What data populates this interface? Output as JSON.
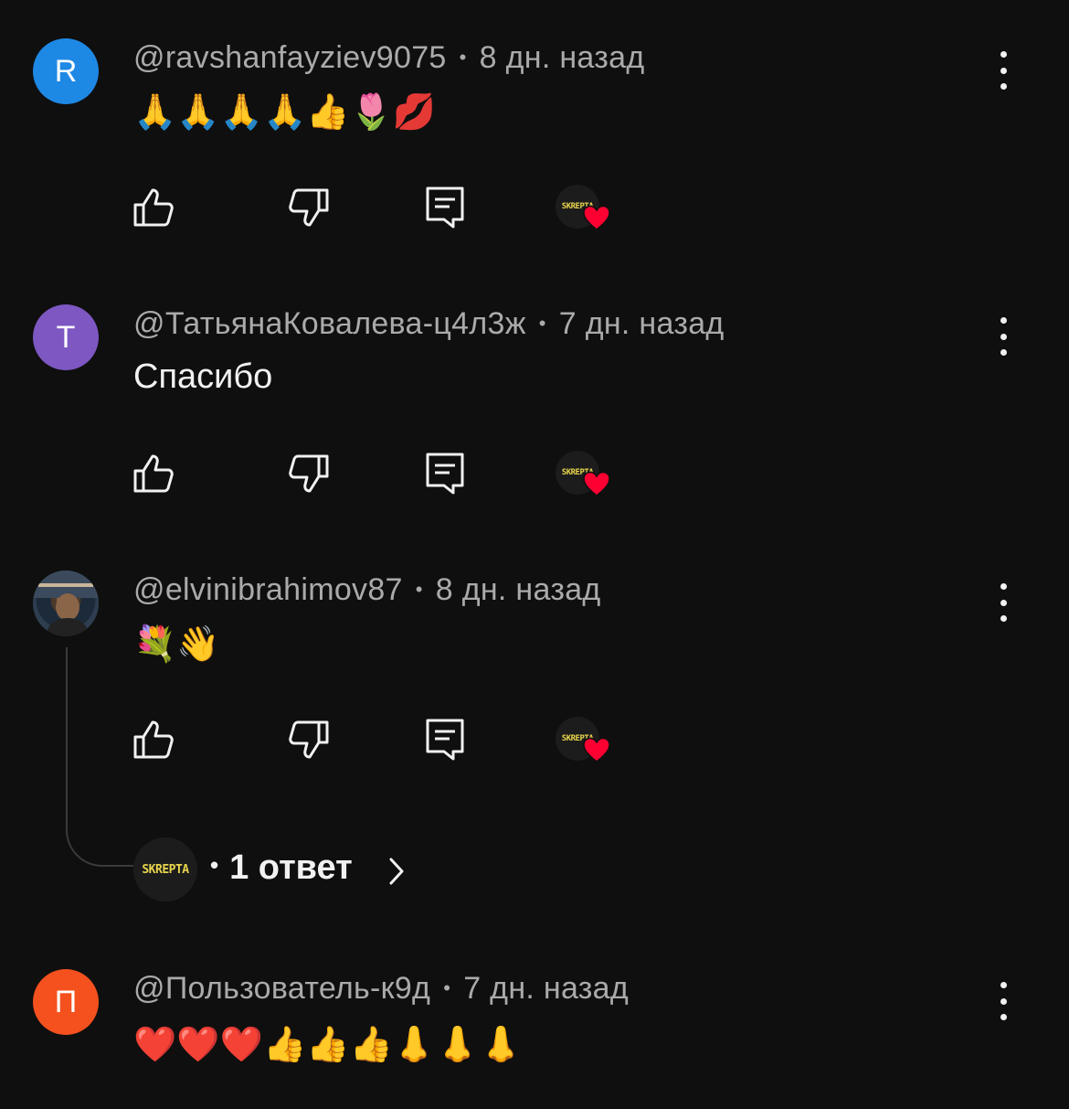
{
  "comments": [
    {
      "avatar_letter": "R",
      "avatar_color": "#1e88e5",
      "author": "@ravshanfayziev9075",
      "time": "8 дн. назад",
      "text": "🙏🙏🙏🙏👍🌷💋"
    },
    {
      "avatar_letter": "T",
      "avatar_color": "#7e57c2",
      "author": "@ТатьянаКовалева-ц4л3ж",
      "time": "7 дн. назад",
      "text": "Спасибо"
    },
    {
      "avatar_letter": "",
      "avatar_color": "",
      "author": "@elvinibrahimov87",
      "time": "8 дн. назад",
      "text": "💐👋",
      "replies_label": "1 ответ"
    },
    {
      "avatar_letter": "П",
      "avatar_color": "#f4511e",
      "author": "@Пользователь-к9д",
      "time": "7 дн. назад",
      "text": "❤️❤️❤️👍👍👍👃👃👃"
    }
  ],
  "separator": "•",
  "channel_badge_text": "SKREPTA",
  "heart_color": "#ff0033",
  "icons": {
    "like": "thumbs-up-icon",
    "dislike": "thumbs-down-icon",
    "reply": "reply-icon",
    "more": "more-vert-icon",
    "expand": "chevron-right-icon"
  }
}
